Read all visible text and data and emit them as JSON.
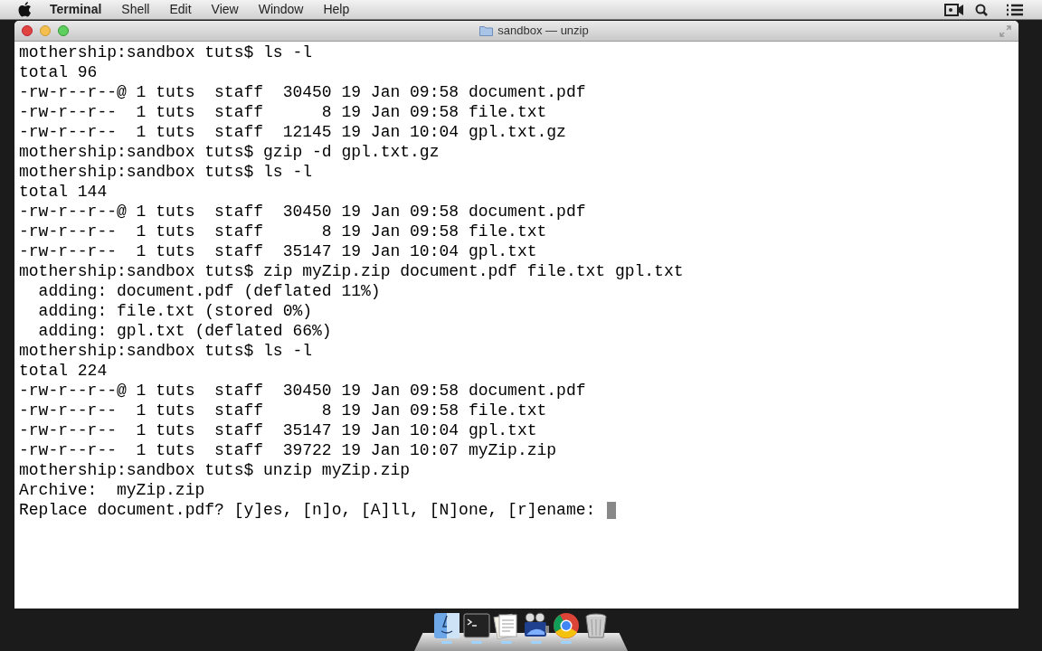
{
  "menu_bar": {
    "app": "Terminal",
    "items": [
      "Shell",
      "Edit",
      "View",
      "Window",
      "Help"
    ]
  },
  "window": {
    "title": "sandbox — unzip"
  },
  "terminal": {
    "cursor_visible": true,
    "lines": [
      "mothership:sandbox tuts$ ls -l",
      "total 96",
      "-rw-r--r--@ 1 tuts  staff  30450 19 Jan 09:58 document.pdf",
      "-rw-r--r--  1 tuts  staff      8 19 Jan 09:58 file.txt",
      "-rw-r--r--  1 tuts  staff  12145 19 Jan 10:04 gpl.txt.gz",
      "mothership:sandbox tuts$ gzip -d gpl.txt.gz",
      "mothership:sandbox tuts$ ls -l",
      "total 144",
      "-rw-r--r--@ 1 tuts  staff  30450 19 Jan 09:58 document.pdf",
      "-rw-r--r--  1 tuts  staff      8 19 Jan 09:58 file.txt",
      "-rw-r--r--  1 tuts  staff  35147 19 Jan 10:04 gpl.txt",
      "mothership:sandbox tuts$ zip myZip.zip document.pdf file.txt gpl.txt",
      "  adding: document.pdf (deflated 11%)",
      "  adding: file.txt (stored 0%)",
      "  adding: gpl.txt (deflated 66%)",
      "mothership:sandbox tuts$ ls -l",
      "total 224",
      "-rw-r--r--@ 1 tuts  staff  30450 19 Jan 09:58 document.pdf",
      "-rw-r--r--  1 tuts  staff      8 19 Jan 09:58 file.txt",
      "-rw-r--r--  1 tuts  staff  35147 19 Jan 10:04 gpl.txt",
      "-rw-r--r--  1 tuts  staff  39722 19 Jan 10:07 myZip.zip",
      "mothership:sandbox tuts$ unzip myZip.zip",
      "Archive:  myZip.zip",
      "Replace document.pdf? [y]es, [n]o, [A]ll, [N]one, [r]ename: "
    ]
  },
  "dock": [
    {
      "kind": "finder",
      "running": true
    },
    {
      "kind": "terminal",
      "running": true
    },
    {
      "kind": "document",
      "running": true
    },
    {
      "kind": "movie",
      "running": true
    },
    {
      "kind": "browser",
      "running": true
    },
    {
      "kind": "trash",
      "running": false
    }
  ]
}
